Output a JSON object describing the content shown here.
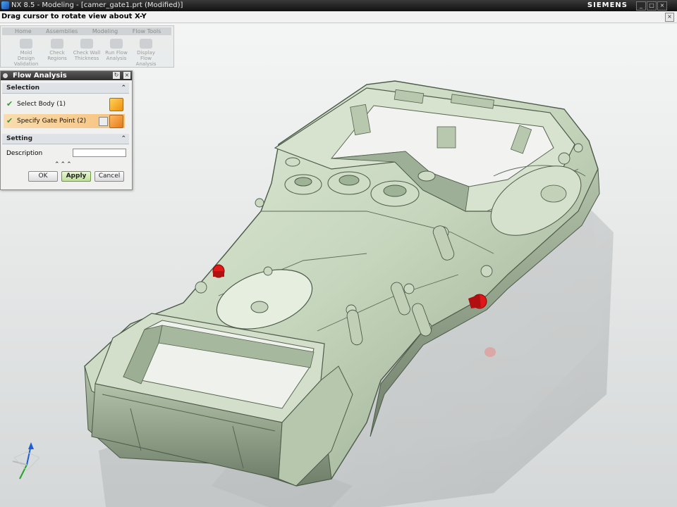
{
  "window": {
    "title": "NX 8.5 - Modeling - [camer_gate1.prt (Modified)]",
    "brand": "SIEMENS",
    "controls": [
      "_",
      "□",
      "×"
    ]
  },
  "prompt": {
    "text": "Drag cursor to rotate view about X-Y",
    "close": "×"
  },
  "ghost_toolbar": {
    "tabs": [
      "Home",
      "Assemblies",
      "Modeling",
      "Flow Tools"
    ],
    "buttons": [
      "Mold Design Validation",
      "Check Regions",
      "Check Wall Thickness",
      "Run Flow Analysis",
      "Display Flow Analysis"
    ]
  },
  "dialog": {
    "title": "Flow Analysis",
    "reset_icon": "↻",
    "close_icon": "×",
    "selection": {
      "header": "Selection",
      "rows": [
        {
          "label": "Select Body (1)",
          "icon": "cube-icon"
        },
        {
          "label": "Specify Gate Point (2)",
          "icon": "point-icon"
        }
      ]
    },
    "setting": {
      "header": "Setting",
      "description_label": "Description",
      "description_value": ""
    },
    "expand": "⌃⌃⌃",
    "buttons": {
      "ok": "OK",
      "apply": "Apply",
      "cancel": "Cancel"
    }
  },
  "colors": {
    "part_face": "#c9d8c0",
    "gate_marker": "#e01818",
    "titlebar": "#1e1e1e",
    "section_header": "#dfe3e8",
    "highlight_row": "#f6c27c"
  }
}
